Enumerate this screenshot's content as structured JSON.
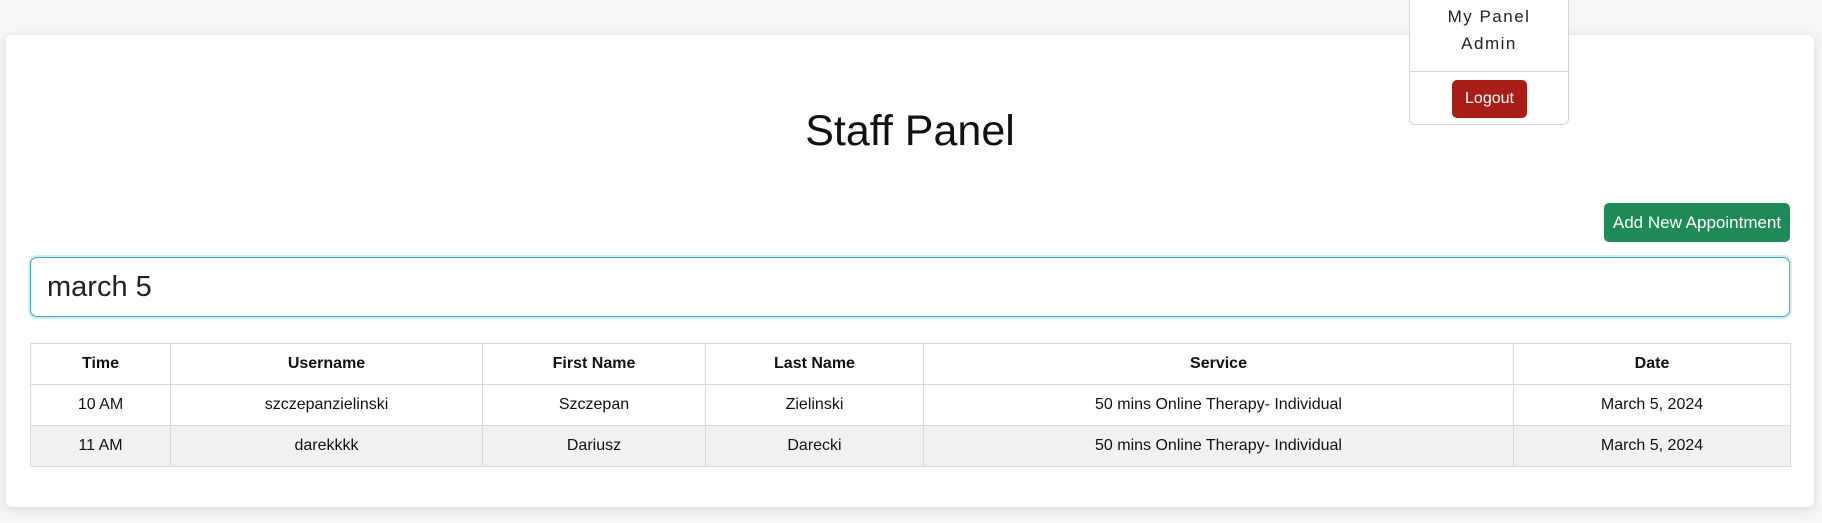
{
  "page": {
    "title": "Staff Panel"
  },
  "menu": {
    "my_panel": "My Panel",
    "admin": "Admin",
    "logout": "Logout"
  },
  "actions": {
    "add_appointment": "Add New Appointment"
  },
  "search": {
    "value": "march 5"
  },
  "table": {
    "headers": [
      "Time",
      "Username",
      "First Name",
      "Last Name",
      "Service",
      "Date"
    ],
    "rows": [
      [
        "10 AM",
        "szczepanzielinski",
        "Szczepan",
        "Zielinski",
        "50 mins Online Therapy- Individual",
        "March 5, 2024"
      ],
      [
        "11 AM",
        "darekkkk",
        "Dariusz",
        "Darecki",
        "50 mins Online Therapy- Individual",
        "March 5, 2024"
      ]
    ]
  },
  "colors": {
    "primary_green": "#1e8a57",
    "danger_red": "#a61e17",
    "search_border": "#4aa6c9"
  }
}
